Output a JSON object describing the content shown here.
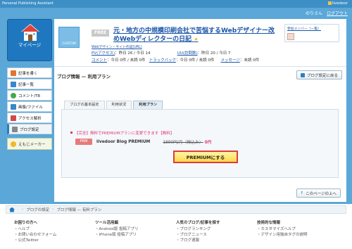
{
  "app_title": "Personal Publishing Assistant",
  "header": {
    "link_label": "livedoor",
    "user": "のりさん",
    "logout_label": "ログアウト"
  },
  "mypage": {
    "label": "マイページ"
  },
  "sidebar": {
    "items": [
      {
        "label": "記事を書く",
        "icon": "pencil-icon",
        "color": "#e6732d"
      },
      {
        "label": "記事一覧",
        "icon": "list-icon",
        "color": "#3a86c8"
      },
      {
        "label": "コメント/TB",
        "icon": "comment-icon",
        "color": "#4aa84a"
      },
      {
        "label": "画像/ファイル",
        "icon": "image-icon",
        "color": "#3a86c8"
      },
      {
        "label": "アクセス解析",
        "icon": "chart-icon",
        "color": "#d04a4a"
      },
      {
        "label": "ブログ設定",
        "icon": "wrench-icon",
        "color": "#888888"
      }
    ],
    "ebi_label": "えもじメーカー"
  },
  "blog": {
    "thumb_label": "CUSTOM",
    "plan_badge": "FREE",
    "title": "元・地方の中規模印刷会社で苦悩するWebデザイナー改めWebディレクターの日記",
    "category": "Webデザイン・サイト作成(URL)",
    "stats": {
      "pv_label": "PV(アクセス)",
      "pv_value": "：昨日 26 / 今日 14",
      "uu_label": "UU(訪問数)",
      "uu_value": "：昨日 20 / 今日 7",
      "comment_label": "コメント",
      "comment_value": "：今日 0件 / 未読 0件",
      "tb_label": "トラックバック",
      "tb_value": "：今日 0件 / 未読 0件",
      "msg_label": "メッセージ",
      "msg_value": "：未読 0件"
    },
    "members_label": "参加メンバー（一覧）"
  },
  "main": {
    "section_title": "ブログ情報 — 利用プラン",
    "settings_button": "ブログ設定に戻る",
    "tabs": [
      {
        "label": "ブログの基本設定"
      },
      {
        "label": "利用状況"
      },
      {
        "label": "利用プラン"
      }
    ],
    "notice": "【完全】無料でPREMIUMプランに変更できます【無料】",
    "plan": {
      "badge": "PRM",
      "name": "livedoor Blog PREMIUM",
      "old_price": "1890円/月（税込み）",
      "new_price": "0円"
    },
    "premium_button": "PREMIUMにする",
    "page_top": "このページの上へ"
  },
  "footer": {
    "breadcrumb": [
      "ブログの設定",
      "ブログ情報 — 有料プラン"
    ],
    "columns": [
      {
        "head": "お困りの方へ",
        "items": [
          "・ヘルプ",
          "・お問い合わせフォーム",
          "・公式Twitter"
        ]
      },
      {
        "head": "ツール活用編",
        "items": [
          "・Android版 投稿アプリ",
          "・iPhone版 投稿アプリ"
        ]
      },
      {
        "head": "人気のブログ/記事を探す",
        "items": [
          "・ブログランキング",
          "・ブログニュース",
          "・ブログ速報"
        ]
      },
      {
        "head": "技術的な情報",
        "items": [
          "・カスタマイズヘルプ",
          "・デザイン用独自タグの説明"
        ]
      }
    ]
  }
}
